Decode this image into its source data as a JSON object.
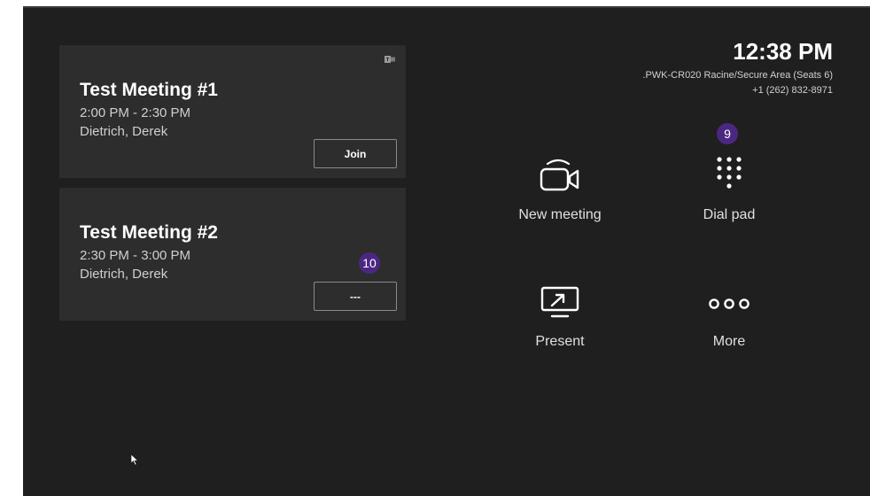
{
  "meetings": [
    {
      "title": "Test Meeting #1",
      "time": "2:00 PM - 2:30 PM",
      "organizer": "Dietrich, Derek",
      "button_label": "Join"
    },
    {
      "title": "Test Meeting #2",
      "time": "2:30 PM - 3:00 PM",
      "organizer": "Dietrich, Derek",
      "button_label": "---"
    }
  ],
  "header": {
    "time": "12:38 PM",
    "room_name": ".PWK-CR020 Racine/Secure Area (Seats 6)",
    "phone": "+1 (262) 832-8971"
  },
  "actions": {
    "new_meeting": "New meeting",
    "dial_pad": "Dial pad",
    "present": "Present",
    "more": "More"
  },
  "badges": {
    "dial_pad": "9",
    "more_options": "10"
  },
  "icons": {
    "teams": "teams-icon",
    "new_meeting": "video-camera-icon",
    "dial_pad": "dialpad-icon",
    "present": "screen-share-icon",
    "more": "more-dots-icon"
  },
  "colors": {
    "background": "#1f1f1f",
    "card": "#2d2d2d",
    "badge": "#4b2782",
    "text": "#ffffff"
  }
}
